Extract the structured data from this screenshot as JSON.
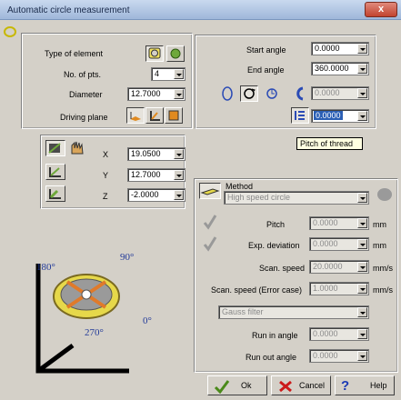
{
  "window": {
    "title": "Automatic circle measurement",
    "close_symbol": "x"
  },
  "element": {
    "type_label": "Type of element",
    "npts_label": "No. of pts.",
    "npts": "4",
    "diameter_label": "Diameter",
    "diameter": "12.7000",
    "plane_label": "Driving plane"
  },
  "coords": {
    "x_label": "X",
    "x": "19.0500",
    "y_label": "Y",
    "y": "12.7000",
    "z_label": "Z",
    "z": "-2.0000"
  },
  "angles": {
    "start_label": "Start angle",
    "start": "0.0000",
    "end_label": "End angle",
    "end": "360.0000",
    "field3": "0.0000",
    "pitch": "0.0000"
  },
  "tooltip": "Pitch of thread",
  "method": {
    "label": "Method",
    "value": "High speed circle",
    "pitch_label": "Pitch",
    "pitch": "0.0000",
    "pitch_unit": "mm",
    "dev_label": "Exp. deviation",
    "dev": "0.0000",
    "dev_unit": "mm",
    "scan_label": "Scan. speed",
    "scan": "20.0000",
    "scan_unit": "mm/s",
    "scanerr_label": "Scan. speed (Error case)",
    "scanerr": "1.0000",
    "scanerr_unit": "mm/s",
    "filter": "Gauss filter",
    "runin_label": "Run in angle",
    "runin": "0.0000",
    "runout_label": "Run out angle",
    "runout": "0.0000"
  },
  "diagram": {
    "a180": "180°",
    "a90": "90°",
    "a0": "0°",
    "a270": "270°"
  },
  "buttons": {
    "ok": "Ok",
    "cancel": "Cancel",
    "help": "Help"
  },
  "colors": {
    "accent": "#2b5fb5",
    "axis_text": "#223a99",
    "ring": "#e6d84a",
    "cross": "#e07a2a"
  }
}
